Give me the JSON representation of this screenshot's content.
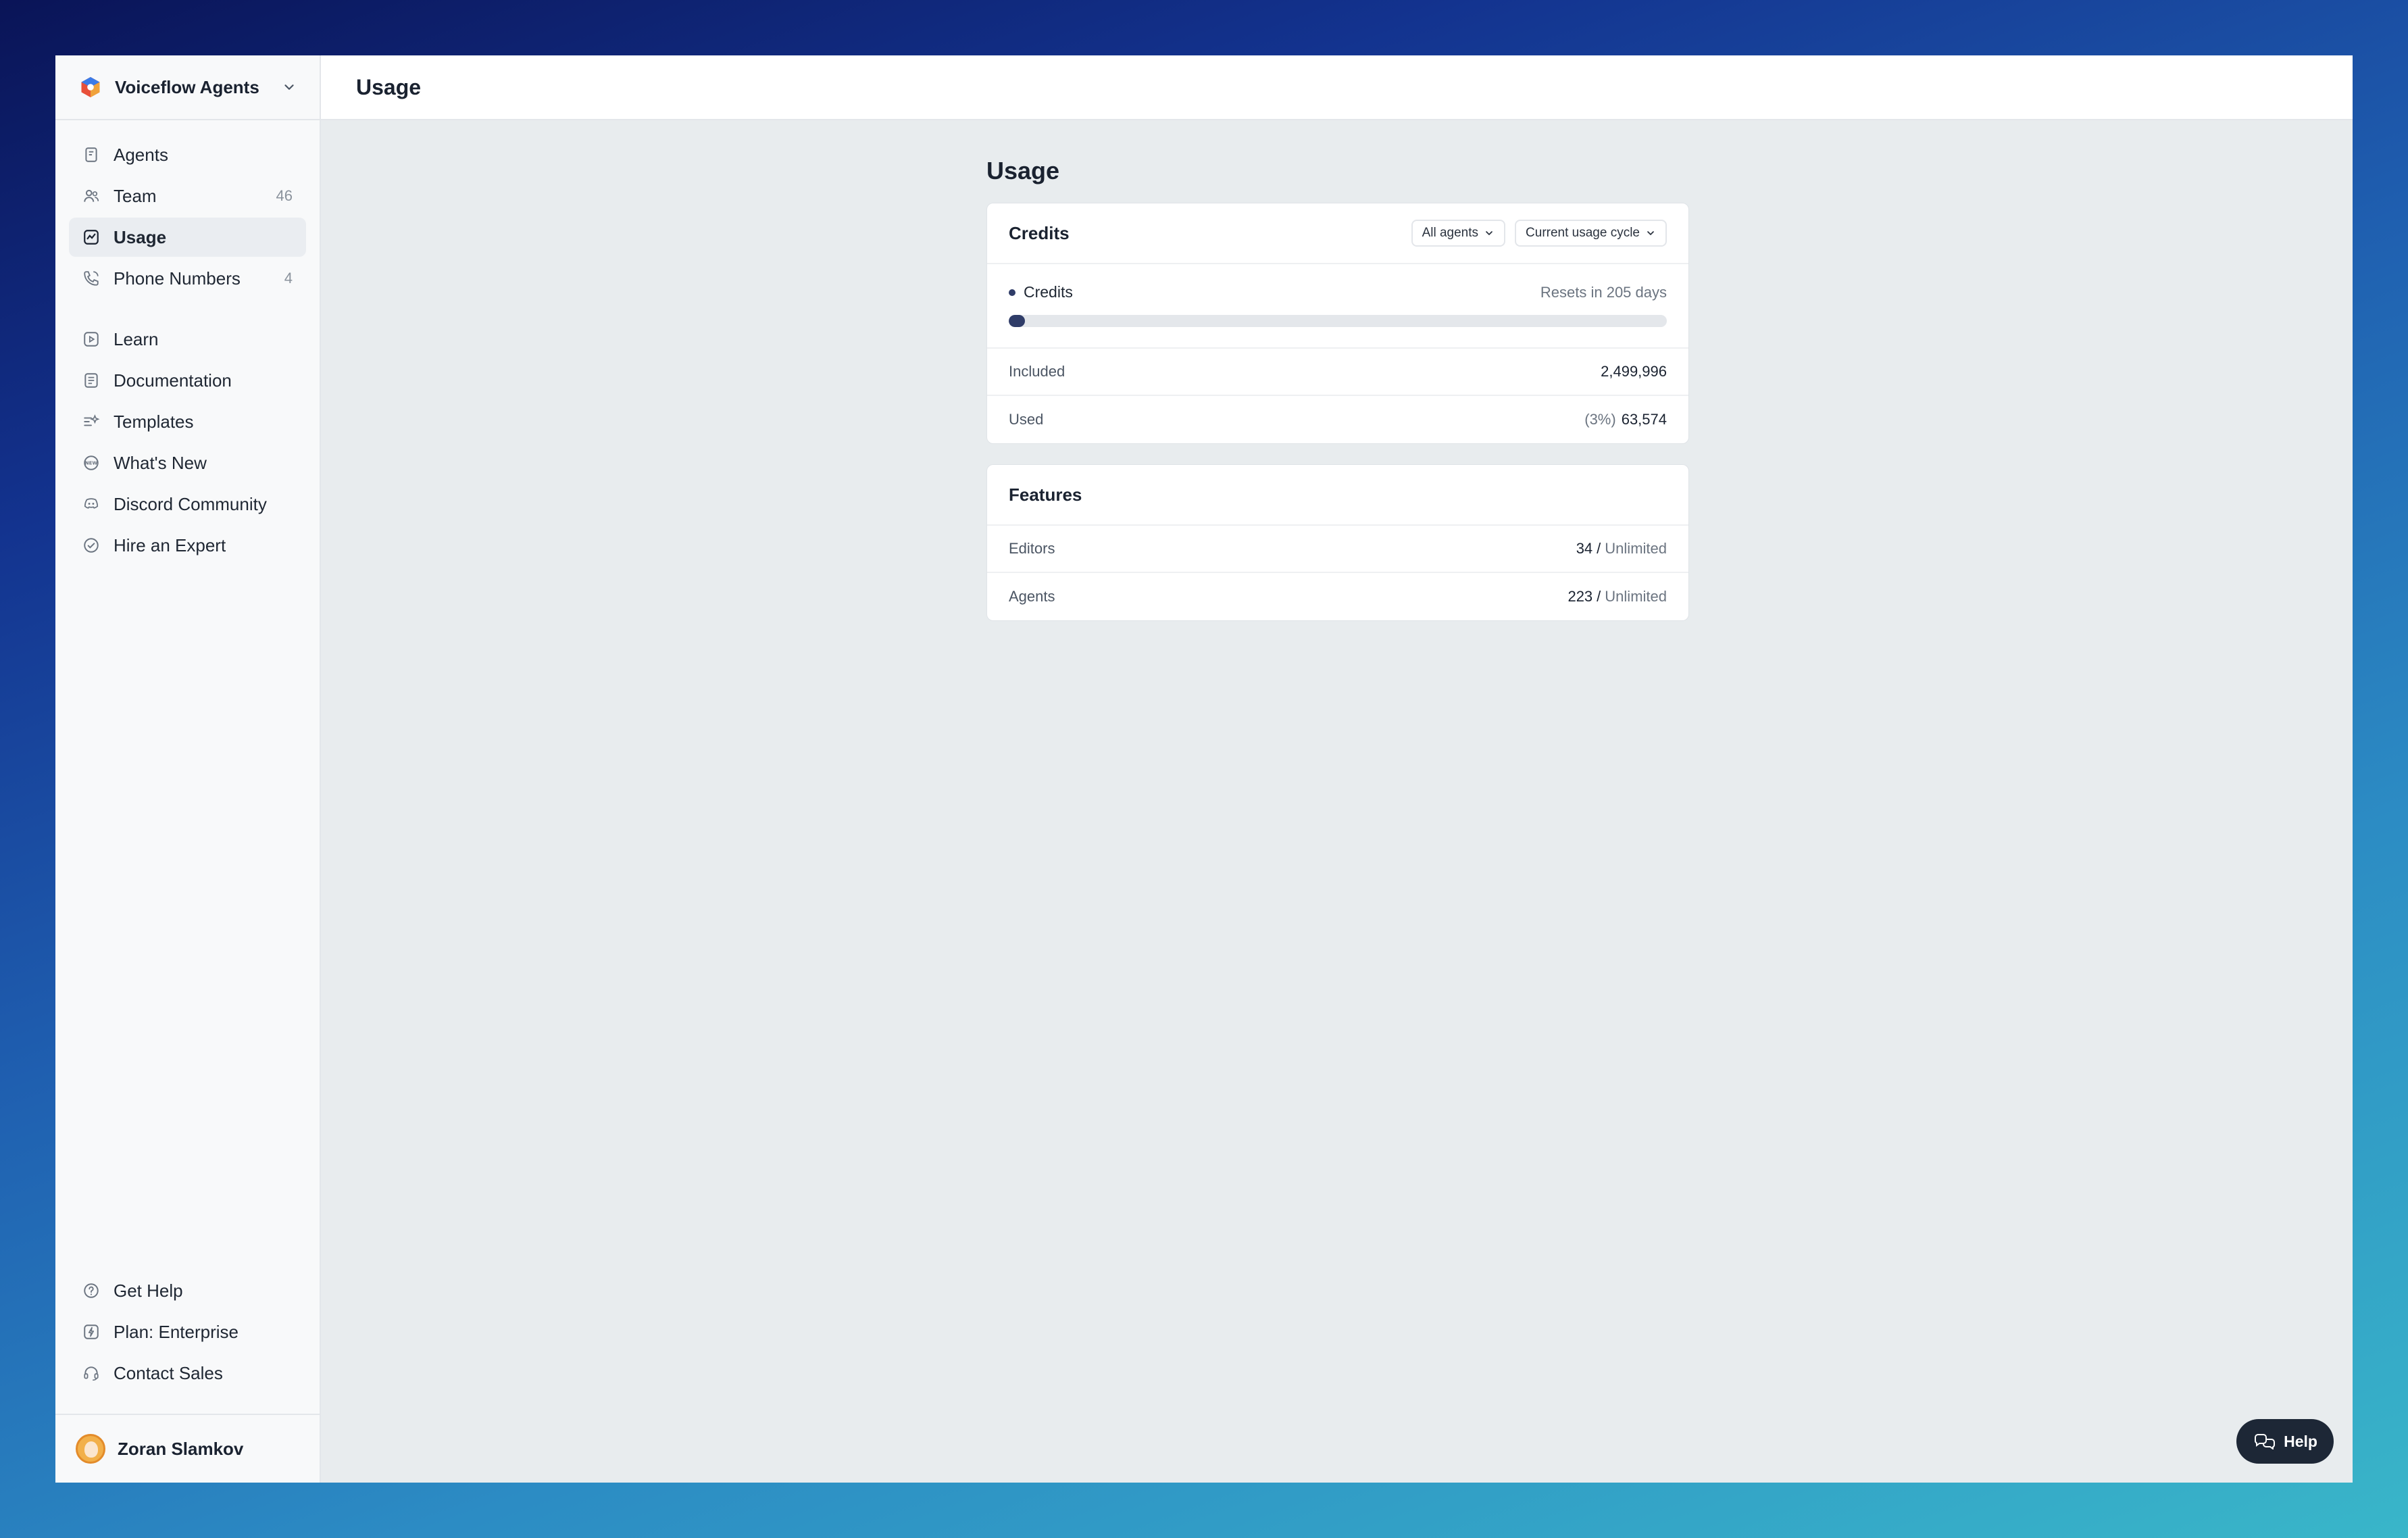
{
  "workspace": {
    "name": "Voiceflow Agents"
  },
  "sidebar": {
    "primary": [
      {
        "label": "Agents",
        "icon": "agents-icon",
        "count": ""
      },
      {
        "label": "Team",
        "icon": "team-icon",
        "count": "46"
      },
      {
        "label": "Usage",
        "icon": "usage-icon",
        "count": "",
        "active": true
      },
      {
        "label": "Phone Numbers",
        "icon": "phone-icon",
        "count": "4"
      }
    ],
    "secondary": [
      {
        "label": "Learn",
        "icon": "learn-icon"
      },
      {
        "label": "Documentation",
        "icon": "documentation-icon"
      },
      {
        "label": "Templates",
        "icon": "templates-icon"
      },
      {
        "label": "What's New",
        "icon": "whats-new-icon"
      },
      {
        "label": "Discord Community",
        "icon": "discord-icon"
      },
      {
        "label": "Hire an Expert",
        "icon": "expert-icon"
      }
    ],
    "bottom": [
      {
        "label": "Get Help",
        "icon": "help-circle-icon"
      },
      {
        "label": "Plan: Enterprise",
        "icon": "plan-icon"
      },
      {
        "label": "Contact Sales",
        "icon": "headset-icon"
      }
    ],
    "user": {
      "name": "Zoran Slamkov"
    }
  },
  "header": {
    "title": "Usage"
  },
  "page": {
    "title": "Usage"
  },
  "credits_card": {
    "title": "Credits",
    "agents_filter": "All agents",
    "cycle_filter": "Current usage cycle",
    "credits_label": "Credits",
    "resets": "Resets in 205 days",
    "used_fraction": 0.025,
    "included_label": "Included",
    "included_value": "2,499,996",
    "used_label": "Used",
    "used_percent": "(3%)",
    "used_value": "63,574"
  },
  "features_card": {
    "title": "Features",
    "rows": [
      {
        "label": "Editors",
        "value": "34",
        "limit": "Unlimited"
      },
      {
        "label": "Agents",
        "value": "223",
        "limit": "Unlimited"
      }
    ]
  },
  "help_button": {
    "label": "Help"
  },
  "colors": {
    "accent": "#2f3c68",
    "help_bg": "#1d2736"
  }
}
